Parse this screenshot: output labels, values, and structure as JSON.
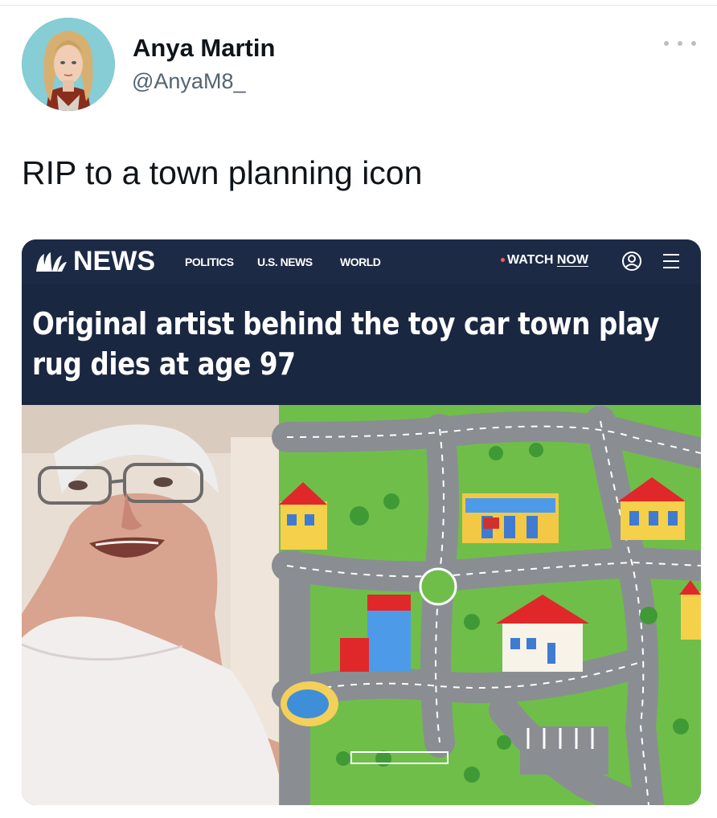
{
  "tweet": {
    "author_name": "Anya Martin",
    "author_handle": "@AnyaM8_",
    "text": "RIP to a town planning icon",
    "more_icon": "ellipsis-icon",
    "avatar_icon": "avatar"
  },
  "card": {
    "site": {
      "brand": "NEWS",
      "logo_icon": "peacock-logo",
      "nav_links": [
        "POLITICS",
        "U.S. NEWS",
        "WORLD"
      ],
      "watch_prefix": "WATCH",
      "watch_now": "NOW",
      "account_icon": "account-icon",
      "menu_icon": "hamburger-menu-icon",
      "colors": {
        "header_bg": "#1d2a46",
        "live_dot": "#ff5a5a"
      }
    },
    "headline": "Original artist behind the toy car town play rug dies at age 97"
  }
}
